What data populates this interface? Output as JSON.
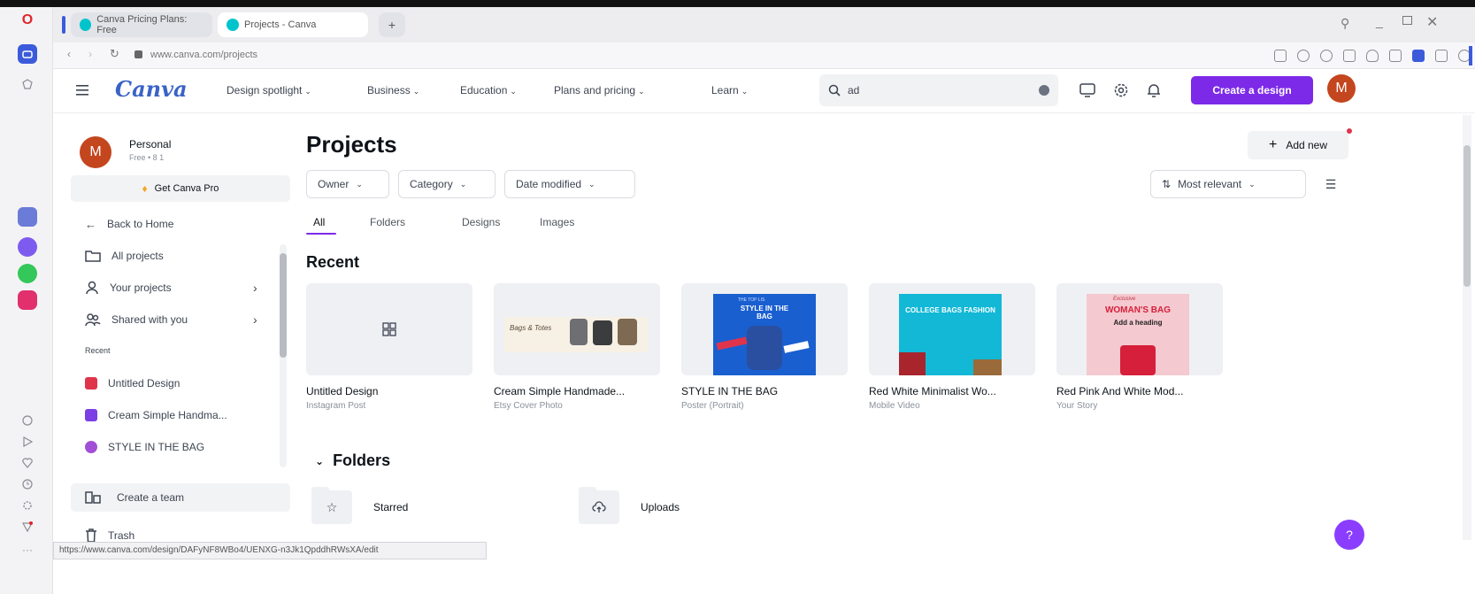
{
  "browser": {
    "tabs": [
      {
        "label": "Canva Pricing Plans: Free"
      },
      {
        "label": "Projects - Canva"
      }
    ],
    "new_tab_icon": "plus-icon",
    "address": "www.canva.com/projects",
    "status_url": "https://www.canva.com/design/DAFyNF8WBo4/UENXG-n3Jk1QpddhRWsXA/edit",
    "window_controls": [
      "search-icon",
      "minimize-icon",
      "restore-icon",
      "close-icon"
    ]
  },
  "header": {
    "logo": "Canva",
    "nav": [
      {
        "label": "Design spotlight"
      },
      {
        "label": "Business"
      },
      {
        "label": "Education"
      },
      {
        "label": "Plans and pricing"
      },
      {
        "label": "Learn"
      }
    ],
    "search_value": "ad",
    "create_label": "Create a design",
    "avatar_letter": "M"
  },
  "sidebar": {
    "account_name": "Personal",
    "account_plan": "Free • 8 1",
    "avatar_letter": "M",
    "get_pro": "Get Canva Pro",
    "back": "Back to Home",
    "items": [
      {
        "label": "All projects",
        "icon": "folder-icon"
      },
      {
        "label": "Your projects",
        "icon": "person-icon"
      },
      {
        "label": "Shared with you",
        "icon": "people-icon"
      }
    ],
    "recent_heading": "Recent",
    "recent": [
      {
        "label": "Untitled Design",
        "color": "#e0344b"
      },
      {
        "label": "Cream Simple Handma...",
        "color": "#7b3fe4"
      },
      {
        "label": "STYLE IN THE BAG",
        "color": "#a24fd8"
      }
    ],
    "create_team": "Create a team",
    "trash": "Trash"
  },
  "main": {
    "title": "Projects",
    "add_new": "Add new",
    "filters": [
      {
        "label": "Owner"
      },
      {
        "label": "Category"
      },
      {
        "label": "Date modified"
      }
    ],
    "sort_label": "Most relevant",
    "tabs": [
      {
        "label": "All"
      },
      {
        "label": "Folders"
      },
      {
        "label": "Designs"
      },
      {
        "label": "Images"
      }
    ],
    "recent_heading": "Recent",
    "designs": [
      {
        "title": "Untitled Design",
        "type": "Instagram Post"
      },
      {
        "title": "Cream Simple Handmade...",
        "type": "Etsy Cover Photo",
        "thumb_text": "Bags & Totes"
      },
      {
        "title": "STYLE IN THE BAG",
        "type": "Poster (Portrait)",
        "thumb_text_top": "THE TOP LIS",
        "thumb_text": "STYLE IN THE BAG"
      },
      {
        "title": "Red White Minimalist Wo...",
        "type": "Mobile Video",
        "thumb_text": "COLLEGE BAGS FASHION"
      },
      {
        "title": "Red Pink And White Mod...",
        "type": "Your Story",
        "thumb_text_top": "Exclusive",
        "thumb_text": "WOMAN'S BAG",
        "thumb_text_2": "Add a heading"
      }
    ],
    "folders_heading": "Folders",
    "folders": [
      {
        "label": "Starred",
        "icon": "star-icon"
      },
      {
        "label": "Uploads",
        "icon": "cloud-upload-icon"
      }
    ],
    "help_label": "?"
  },
  "colors": {
    "accent": "#7d2ae8",
    "avatar": "#c4461e",
    "canva_logo": "#3a63c7"
  }
}
